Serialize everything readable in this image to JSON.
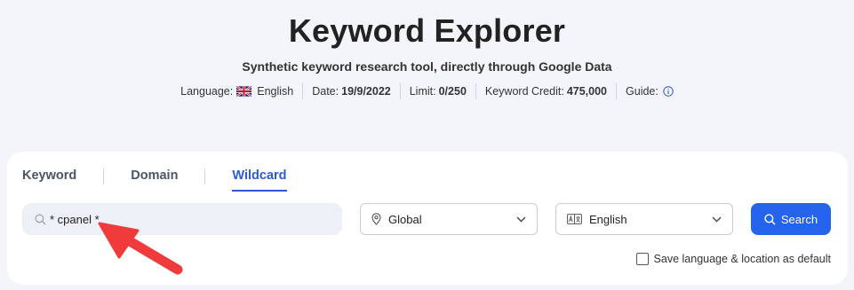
{
  "header": {
    "title": "Keyword Explorer",
    "subtitle": "Synthetic keyword research tool, directly through Google Data"
  },
  "meta": {
    "language_label": "Language:",
    "language_value": "English",
    "date_label": "Date:",
    "date_value": "19/9/2022",
    "limit_label": "Limit:",
    "limit_value": "0/250",
    "credit_label": "Keyword Credit:",
    "credit_value": "475,000",
    "guide_label": "Guide:"
  },
  "tabs": [
    {
      "label": "Keyword",
      "active": false
    },
    {
      "label": "Domain",
      "active": false
    },
    {
      "label": "Wildcard",
      "active": true
    }
  ],
  "search": {
    "value": "* cpanel *"
  },
  "location_select": {
    "value": "Global"
  },
  "language_select": {
    "value": "English"
  },
  "search_button": {
    "label": "Search"
  },
  "save_default": {
    "label": "Save language & location as default",
    "checked": false
  },
  "colors": {
    "accent": "#2463eb",
    "annotation_arrow": "#ef3b3b"
  }
}
